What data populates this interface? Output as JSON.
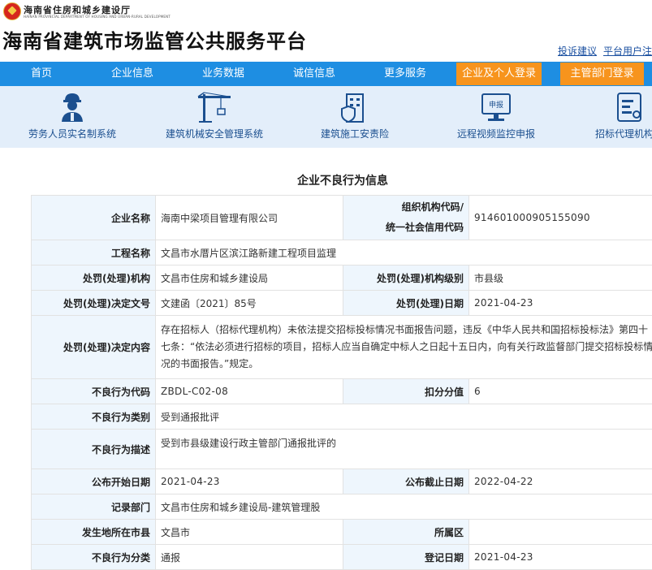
{
  "header": {
    "department": "海南省住房和城乡建设厅",
    "department_en": "HAINAN PROVINCIAL DEPARTMENT OF HOUSING AND URBAN-RURAL DEVELOPMENT",
    "site_title": "海南省建筑市场监管公共服务平台",
    "links": [
      "投诉建议",
      "平台用户注"
    ]
  },
  "nav": {
    "items": [
      "首页",
      "企业信息",
      "业务数据",
      "诚信信息",
      "更多服务"
    ],
    "login_personal": "企业及个人登录",
    "login_admin": "主管部门登录"
  },
  "services": [
    {
      "label": "劳务人员实名制系统",
      "icon": "worker-icon"
    },
    {
      "label": "建筑机械安全管理系统",
      "icon": "tower-crane-icon"
    },
    {
      "label": "建筑施工安责险",
      "icon": "building-shield-icon"
    },
    {
      "label": "远程视频监控申报",
      "icon": "monitor-report-icon"
    },
    {
      "label": "招标代理机构信",
      "icon": "document-icon"
    }
  ],
  "page_heading": "企业不良行为信息",
  "record": {
    "company_name_label": "企业名称",
    "company_name": "海南中梁项目管理有限公司",
    "org_code_label_1": "组织机构代码/",
    "org_code_label_2": "统一社会信用代码",
    "org_code": "914601000905155090",
    "project_label": "工程名称",
    "project": "文昌市水厝片区滨江路新建工程项目监理",
    "penalty_org_label": "处罚(处理)机构",
    "penalty_org": "文昌市住房和城乡建设局",
    "penalty_level_label": "处罚(处理)机构级别",
    "penalty_level": "市县级",
    "decision_no_label": "处罚(处理)决定文号",
    "decision_no": "文建函〔2021〕85号",
    "penalty_date_label": "处罚(处理)日期",
    "penalty_date": "2021-04-23",
    "decision_content_label": "处罚(处理)决定内容",
    "decision_content": "存在招标人（招标代理机构）未依法提交招标投标情况书面报告问题，违反《中华人民共和国招标投标法》第四十七条：“依法必须进行招标的项目，招标人应当自确定中标人之日起十五日内，向有关行政监督部门提交招标投标情况的书面报告。”规定。",
    "code_label": "不良行为代码",
    "code": "ZBDL-C02-08",
    "score_label": "扣分分值",
    "score": "6",
    "category_label": "不良行为类别",
    "category": "受到通报批评",
    "description_label": "不良行为描述",
    "description": "受到市县级建设行政主管部门通报批评的",
    "publish_start_label": "公布开始日期",
    "publish_start": "2021-04-23",
    "publish_end_label": "公布截止日期",
    "publish_end": "2022-04-22",
    "record_dept_label": "记录部门",
    "record_dept": "文昌市住房和城乡建设局-建筑管理股",
    "city_label": "发生地所在市县",
    "city": "文昌市",
    "district_label": "所属区",
    "district": "",
    "classification_label": "不良行为分类",
    "classification": "通报",
    "register_date_label": "登记日期",
    "register_date": "2021-04-23"
  }
}
